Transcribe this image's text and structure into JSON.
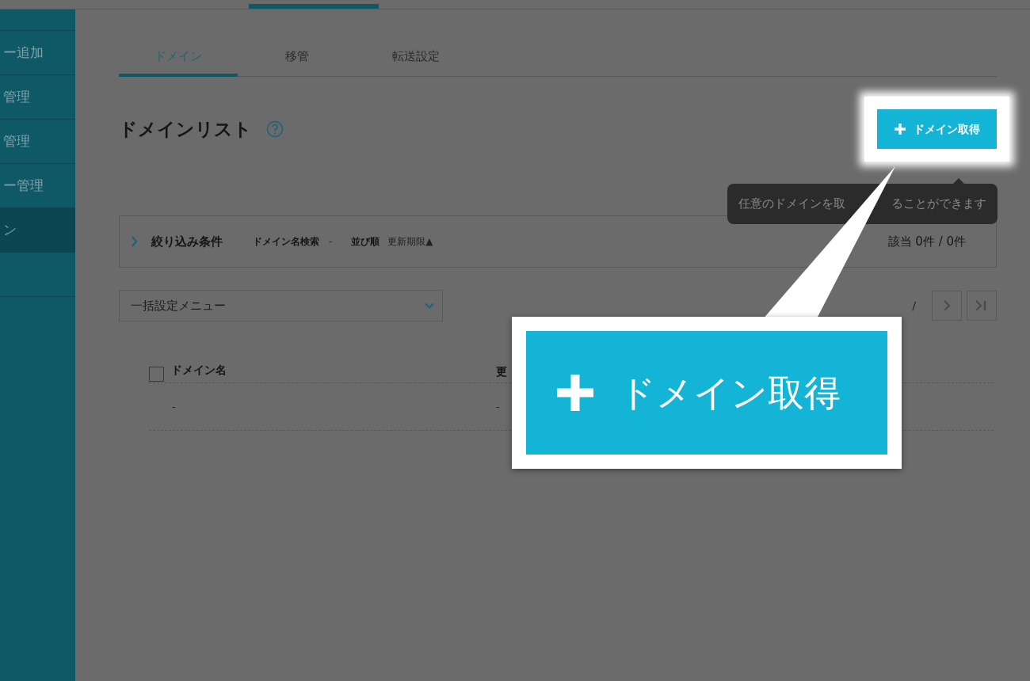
{
  "sidebar": {
    "items": [
      {
        "label": "ー追加",
        "selected": false
      },
      {
        "label": "管理",
        "selected": false
      },
      {
        "label": "管理",
        "selected": false
      },
      {
        "label": "ー管理",
        "selected": false
      },
      {
        "label": "ン",
        "selected": true
      },
      {
        "selected": false
      }
    ]
  },
  "tabs": [
    {
      "label": "ドメイン",
      "selected": true
    },
    {
      "label": "移管",
      "selected": false
    },
    {
      "label": "転送設定",
      "selected": false
    }
  ],
  "header": {
    "title": "ドメインリスト",
    "button": "ドメイン取得",
    "tooltip": [
      "任意のドメインを取",
      "ることができます"
    ]
  },
  "filter": {
    "label": "絞り込み条件",
    "expanded": false,
    "search_label": "ドメイン名検索",
    "search_value": "-",
    "sort_label": "並び順",
    "sort_value": "更新期限▲",
    "count": "該当 0件 / 0件"
  },
  "bulk_menu": {
    "value": "一括設定メニュー"
  },
  "pagination": {
    "separator": "/"
  },
  "table": {
    "select_all": {
      "checked": false
    },
    "columns": [
      "ドメイン名",
      "更"
    ],
    "rows": [
      [
        "-",
        "-"
      ]
    ]
  },
  "callout": {
    "label": "ドメイン取得"
  }
}
